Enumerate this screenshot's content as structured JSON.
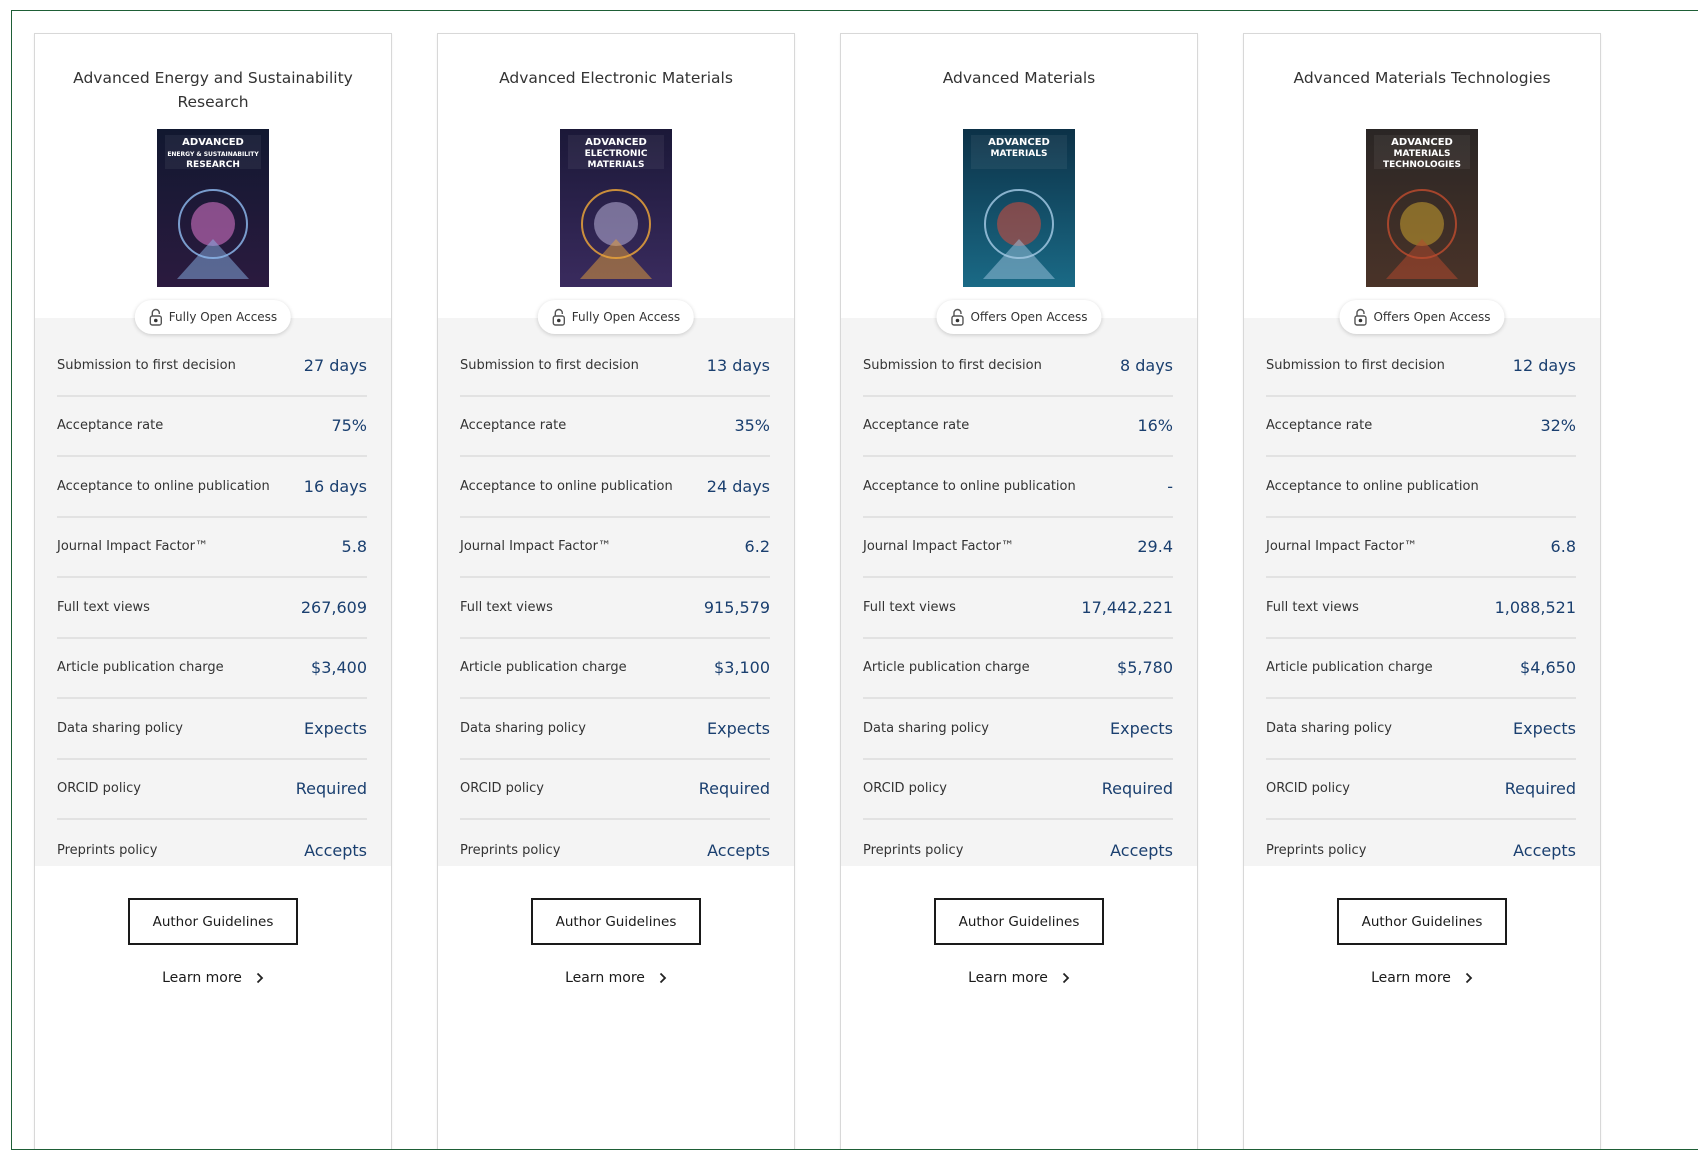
{
  "cards": [
    {
      "title": "Advanced Energy and Sustainability Research",
      "cover_icon": "journal-cover-energy-sustainability",
      "open_access": "Fully Open Access",
      "metrics": [
        {
          "label": "Submission to first decision",
          "value": "27 days"
        },
        {
          "label": "Acceptance rate",
          "value": "75%"
        },
        {
          "label": "Acceptance to online publication",
          "value": "16 days"
        },
        {
          "label": "Journal Impact Factor™",
          "value": "5.8"
        },
        {
          "label": "Full text views",
          "value": "267,609"
        },
        {
          "label": "Article publication charge",
          "value": "$3,400"
        },
        {
          "label": "Data sharing policy",
          "value": "Expects"
        },
        {
          "label": "ORCID policy",
          "value": "Required"
        },
        {
          "label": "Preprints policy",
          "value": "Accepts"
        }
      ],
      "guidelines_label": "Author Guidelines",
      "learn_more_label": "Learn more"
    },
    {
      "title": "Advanced Electronic Materials",
      "cover_icon": "journal-cover-electronic-materials",
      "open_access": "Fully Open Access",
      "metrics": [
        {
          "label": "Submission to first decision",
          "value": "13 days"
        },
        {
          "label": "Acceptance rate",
          "value": "35%"
        },
        {
          "label": "Acceptance to online publication",
          "value": "24 days"
        },
        {
          "label": "Journal Impact Factor™",
          "value": "6.2"
        },
        {
          "label": "Full text views",
          "value": "915,579"
        },
        {
          "label": "Article publication charge",
          "value": "$3,100"
        },
        {
          "label": "Data sharing policy",
          "value": "Expects"
        },
        {
          "label": "ORCID policy",
          "value": "Required"
        },
        {
          "label": "Preprints policy",
          "value": "Accepts"
        }
      ],
      "guidelines_label": "Author Guidelines",
      "learn_more_label": "Learn more"
    },
    {
      "title": "Advanced Materials",
      "cover_icon": "journal-cover-advanced-materials",
      "open_access": "Offers Open Access",
      "metrics": [
        {
          "label": "Submission to first decision",
          "value": "8 days"
        },
        {
          "label": "Acceptance rate",
          "value": "16%"
        },
        {
          "label": "Acceptance to online publication",
          "value": "-"
        },
        {
          "label": "Journal Impact Factor™",
          "value": "29.4"
        },
        {
          "label": "Full text views",
          "value": "17,442,221"
        },
        {
          "label": "Article publication charge",
          "value": "$5,780"
        },
        {
          "label": "Data sharing policy",
          "value": "Expects"
        },
        {
          "label": "ORCID policy",
          "value": "Required"
        },
        {
          "label": "Preprints policy",
          "value": "Accepts"
        }
      ],
      "guidelines_label": "Author Guidelines",
      "learn_more_label": "Learn more"
    },
    {
      "title": "Advanced Materials Technologies",
      "cover_icon": "journal-cover-materials-technologies",
      "open_access": "Offers Open Access",
      "metrics": [
        {
          "label": "Submission to first decision",
          "value": "12 days"
        },
        {
          "label": "Acceptance rate",
          "value": "32%"
        },
        {
          "label": "Acceptance to online publication",
          "value": ""
        },
        {
          "label": "Journal Impact Factor™",
          "value": "6.8"
        },
        {
          "label": "Full text views",
          "value": "1,088,521"
        },
        {
          "label": "Article publication charge",
          "value": "$4,650"
        },
        {
          "label": "Data sharing policy",
          "value": "Expects"
        },
        {
          "label": "ORCID policy",
          "value": "Required"
        },
        {
          "label": "Preprints policy",
          "value": "Accepts"
        }
      ],
      "guidelines_label": "Author Guidelines",
      "learn_more_label": "Learn more"
    }
  ],
  "covers": [
    {
      "bg_top": "#111830",
      "bg_bottom": "#2b1a3f",
      "accent": "#8ab4e8",
      "accent2": "#e07ad0",
      "mast_lines": [
        "ADVANCED",
        "ENERGY & SUSTAINABILITY",
        "RESEARCH"
      ]
    },
    {
      "bg_top": "#1b1838",
      "bg_bottom": "#3a2b5e",
      "accent": "#e8a23a",
      "accent2": "#b9b2d8",
      "mast_lines": [
        "ADVANCED",
        "ELECTRONIC",
        "MATERIALS"
      ]
    },
    {
      "bg_top": "#0c3147",
      "bg_bottom": "#1a6a86",
      "accent": "#9fc6e0",
      "accent2": "#d94a3a",
      "mast_lines": [
        "ADVANCED",
        "MATERIALS"
      ]
    },
    {
      "bg_top": "#2a2625",
      "bg_bottom": "#4a3328",
      "accent": "#b84a2e",
      "accent2": "#c9a030",
      "mast_lines": [
        "ADVANCED",
        "MATERIALS",
        "TECHNOLOGIES"
      ]
    }
  ]
}
